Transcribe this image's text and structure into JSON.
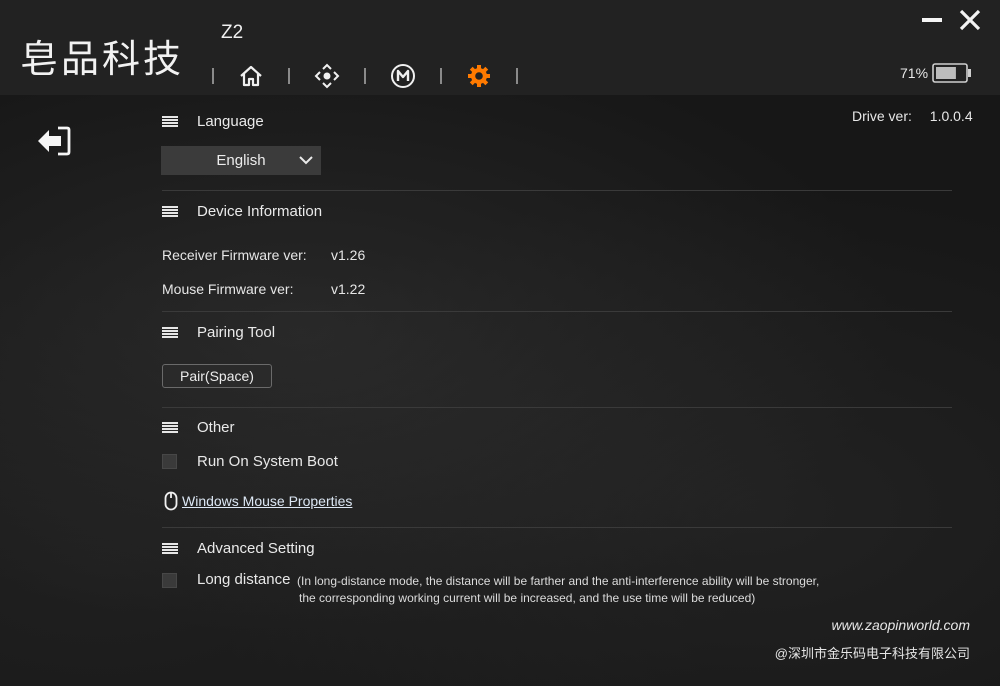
{
  "app": {
    "logo_text": "皂品科技",
    "model": "Z2",
    "window_controls": {
      "minimize_icon": "minimize-icon",
      "close_icon": "close-icon"
    },
    "nav_tabs": [
      {
        "name": "home",
        "icon": "home-icon",
        "active": false
      },
      {
        "name": "move",
        "icon": "move-icon",
        "active": false
      },
      {
        "name": "macro",
        "icon": "macro-m-icon",
        "active": false
      },
      {
        "name": "settings",
        "icon": "gear-icon",
        "active": true
      }
    ],
    "accent_color": "#ff7a00",
    "battery": {
      "percent_label": "71%",
      "level": 0.71
    }
  },
  "content": {
    "back_icon": "exit-arrow-icon",
    "drive": {
      "label": "Drive ver:",
      "value": "1.0.0.4"
    },
    "language": {
      "title": "Language",
      "selected": "English"
    },
    "device_info": {
      "title": "Device Information",
      "rows": [
        {
          "label": "Receiver Firmware ver:",
          "value": "v1.26"
        },
        {
          "label": "Mouse Firmware ver:",
          "value": "v1.22"
        }
      ]
    },
    "pairing": {
      "title": "Pairing Tool",
      "button": "Pair(Space)"
    },
    "other": {
      "title": "Other",
      "run_on_boot": {
        "label": "Run On System Boot",
        "checked": false
      },
      "mouse_properties_link": "Windows Mouse Properties"
    },
    "advanced": {
      "title": "Advanced Setting",
      "long_distance": {
        "label": "Long distance",
        "checked": false
      },
      "note_line1": "(In long-distance mode, the distance will be farther and the anti-interference ability will be stronger,",
      "note_line2": "the corresponding working current will be increased, and the use time will be reduced)"
    },
    "footer": {
      "website": "www.zaopinworld.com",
      "company": "@深圳市金乐码电子科技有限公司"
    }
  }
}
